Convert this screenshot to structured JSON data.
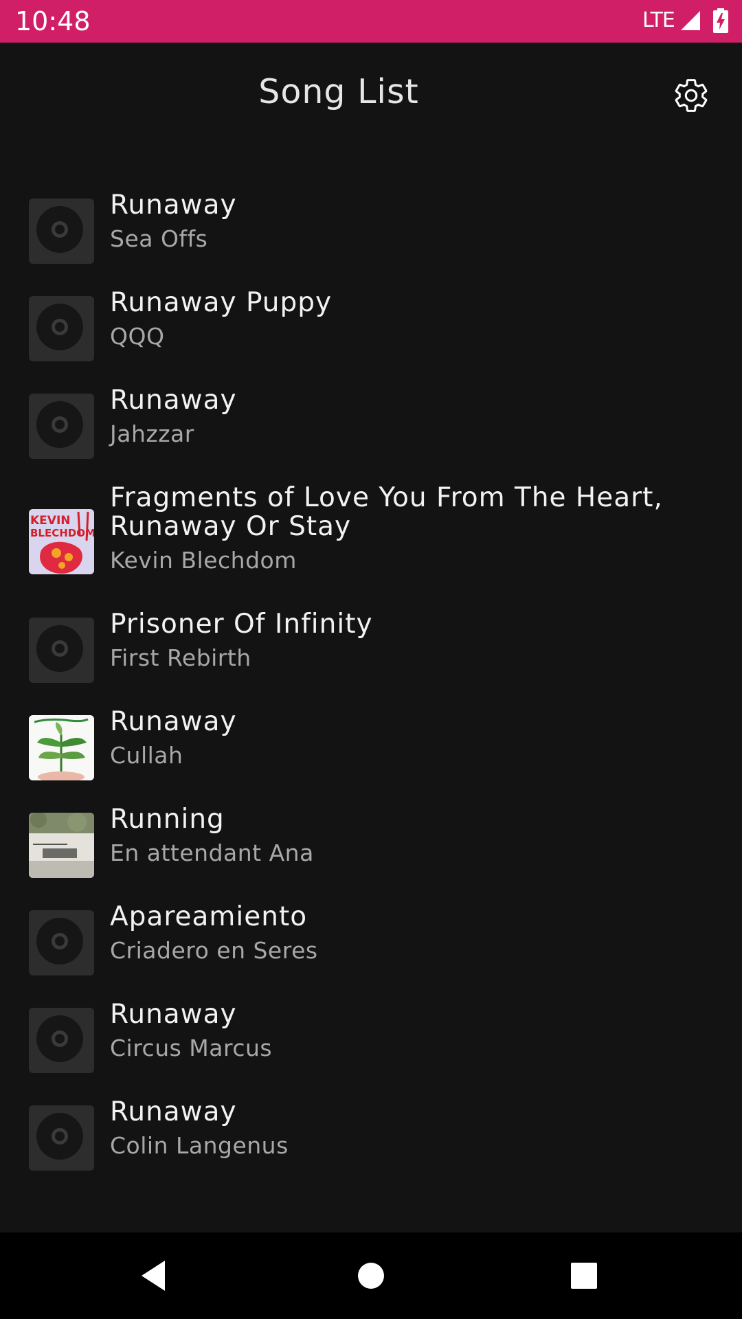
{
  "status_bar": {
    "time": "10:48",
    "network": "LTE",
    "icons": [
      "signal-icon",
      "battery-charging-icon"
    ]
  },
  "app_bar": {
    "title": "Song List",
    "settings_icon": "gear-icon"
  },
  "songs": [
    {
      "title": "Runaway",
      "artist": "Sea Offs",
      "art": "placeholder-disc"
    },
    {
      "title": "Runaway Puppy",
      "artist": "QQQ",
      "art": "placeholder-disc"
    },
    {
      "title": "Runaway",
      "artist": "Jahzzar",
      "art": "placeholder-disc"
    },
    {
      "title": "Fragments of Love You From The Heart, Runaway Or Stay",
      "artist": "Kevin Blechdom",
      "art": "album-cover",
      "art_text": "KEVIN BLECHDOM"
    },
    {
      "title": "Prisoner Of Infinity",
      "artist": "First Rebirth",
      "art": "placeholder-disc"
    },
    {
      "title": "Runaway",
      "artist": "Cullah",
      "art": "album-cover"
    },
    {
      "title": "Running",
      "artist": "En attendant Ana",
      "art": "album-cover"
    },
    {
      "title": "Apareamiento",
      "artist": "Criadero en Seres",
      "art": "placeholder-disc"
    },
    {
      "title": "Runaway",
      "artist": "Circus Marcus",
      "art": "placeholder-disc"
    },
    {
      "title": "Runaway",
      "artist": "Colin Langenus",
      "art": "placeholder-disc"
    }
  ],
  "nav_bar": {
    "buttons": [
      "back-icon",
      "home-icon",
      "recents-icon"
    ]
  },
  "colors": {
    "status_bar": "#d01f66",
    "background": "#131313",
    "title_text": "#f2f2f2",
    "artist_text": "#a8a8a8"
  }
}
